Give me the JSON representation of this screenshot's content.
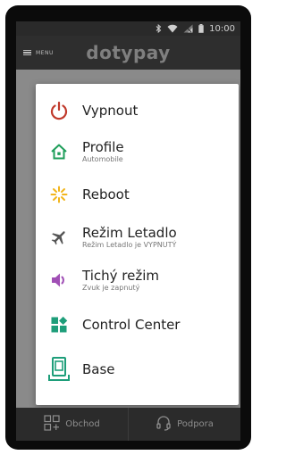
{
  "status_bar": {
    "time": "10:00"
  },
  "app": {
    "menu_label": "MENU",
    "logo_text": "dotypay"
  },
  "menu": {
    "items": [
      {
        "label": "Vypnout",
        "sub": "",
        "icon": "power-icon",
        "color": "#c0392b"
      },
      {
        "label": "Profile",
        "sub": "Automobile",
        "icon": "home-icon",
        "color": "#1e9e5a"
      },
      {
        "label": "Reboot",
        "sub": "",
        "icon": "reboot-icon",
        "color": "#f2b51c"
      },
      {
        "label": "Režim Letadlo",
        "sub": "Režim Letadlo je VYPNUTÝ",
        "icon": "airplane-icon",
        "color": "#555555"
      },
      {
        "label": "Tichý režim",
        "sub": "Zvuk je zapnutý",
        "icon": "volume-icon",
        "color": "#a04fb5"
      },
      {
        "label": "Control Center",
        "sub": "",
        "icon": "control-center-icon",
        "color": "#1e9e7a"
      },
      {
        "label": "Base",
        "sub": "",
        "icon": "base-icon",
        "color": "#1e9e7a"
      }
    ]
  },
  "bottom_nav": {
    "obchod": "Obchod",
    "podpora": "Podpora"
  }
}
